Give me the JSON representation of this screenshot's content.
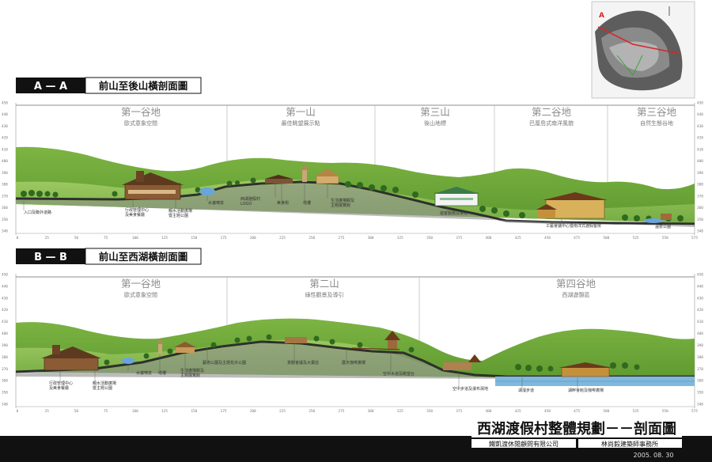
{
  "sections": [
    {
      "id": "aa",
      "letter": "A — A",
      "title": "前山至後山橫剖面圖",
      "zones": [
        {
          "name": "第一谷地",
          "sub": "歐式意象空間"
        },
        {
          "name": "第一山",
          "sub": "最佳眺望展示點"
        },
        {
          "name": "第三山",
          "sub": "後山地標"
        },
        {
          "name": "第二谷地",
          "sub": "巴厘島式南洋風貌"
        },
        {
          "name": "第三谷地",
          "sub": "自然生態谷地"
        }
      ],
      "labels": [
        [
          "入口及聯外道路"
        ],
        [
          "行政管理中心",
          "及美食餐廳"
        ],
        [
          "親水活動廣場",
          "暨主題公園"
        ],
        [
          "水濂噴泉"
        ],
        [
          "西湖渡假村",
          "LOGO"
        ],
        [
          "美食街"
        ],
        [
          "塔樓"
        ],
        [
          "生活廣場觀及",
          "主題展覽館"
        ],
        [
          "遊客服務及車站"
        ],
        [
          "工藝會議中心暨南洋式渡假客房"
        ],
        [
          "溫泉公園"
        ]
      ]
    },
    {
      "id": "bb",
      "letter": "B — B",
      "title": "前山至西湖橫剖面圖",
      "zones": [
        {
          "name": "第一谷地",
          "sub": "歐式意象空間"
        },
        {
          "name": "第二山",
          "sub": "綠性觀景及導引"
        },
        {
          "name": "第四谷地",
          "sub": "西湖遊憩區"
        }
      ],
      "labels": [
        [
          "行政管理中心",
          "及美食餐廳"
        ],
        [
          "親水活動廣場",
          "暨主題公園"
        ],
        [
          "水濂噴泉"
        ],
        [
          "塔樓"
        ],
        [
          "生活廣場觀及",
          "主題展覽館"
        ],
        [
          "藝術公園及主題花卉公園"
        ],
        [
          "景觀會議及大賣店"
        ],
        [
          "露天咖啡廣場"
        ],
        [
          "空中木道及眺望台"
        ],
        [
          "空中步道及瀑布濕地"
        ],
        [
          "湖濱步道"
        ],
        [
          "湖畔會館及咖啡廣場"
        ]
      ]
    }
  ],
  "x_ticks": [
    "0",
    "25",
    "50",
    "75",
    "100",
    "125",
    "150",
    "175",
    "200",
    "225",
    "250",
    "275",
    "300",
    "325",
    "350",
    "375",
    "400",
    "425",
    "450",
    "475",
    "500",
    "525",
    "550",
    "575"
  ],
  "y_ticks": [
    "450",
    "440",
    "430",
    "420",
    "410",
    "400",
    "390",
    "380",
    "370",
    "360",
    "350",
    "340"
  ],
  "footer": {
    "main_title": "西湖渡假村整體規劃－－剖面圖",
    "company_left": "鐵凱渡休閒顧問有限公司",
    "company_right": "林尚毅建築師事務所",
    "date": "2005. 08. 30"
  },
  "inset_marker": "A",
  "colors": {
    "hill": "#8dbb4c",
    "hill_far": "#6ea23a",
    "ground": "#3a3a3a",
    "water": "#7fb8dd",
    "roof": "#7a4e2c"
  }
}
